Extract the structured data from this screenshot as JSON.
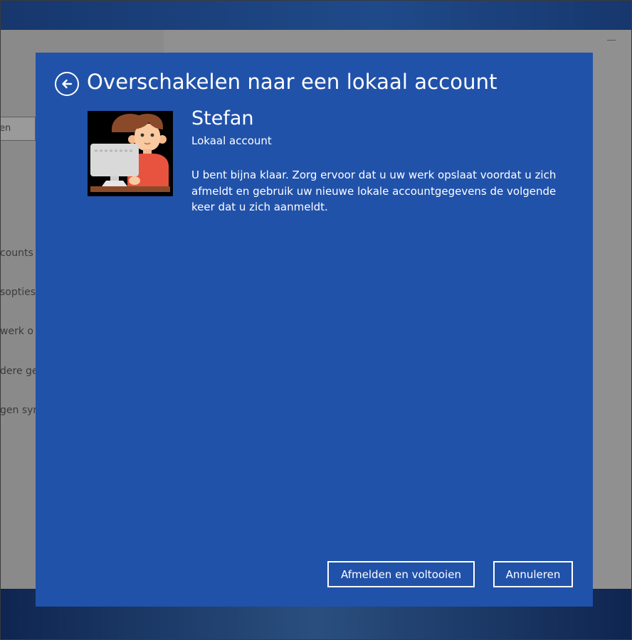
{
  "background": {
    "search_text": "en",
    "nav_items": [
      "counts",
      "sopties",
      "werk o",
      "dere ge",
      "gen syn"
    ]
  },
  "dialog": {
    "title": "Overschakelen naar een lokaal account",
    "back_icon": "arrow-left-circle-icon",
    "user": {
      "name": "Stefan",
      "account_type": "Lokaal account"
    },
    "message": "U bent bijna klaar. Zorg ervoor dat u uw werk opslaat voordat u zich afmeldt en gebruik uw nieuwe lokale accountgegevens de volgende keer dat u zich aanmeldt.",
    "buttons": {
      "finish_label": "Afmelden en voltooien",
      "cancel_label": "Annuleren"
    }
  },
  "colors": {
    "dialog_bg": "#2152aa",
    "text": "#ffffff",
    "dimmed_window": "#8d8d8d"
  }
}
